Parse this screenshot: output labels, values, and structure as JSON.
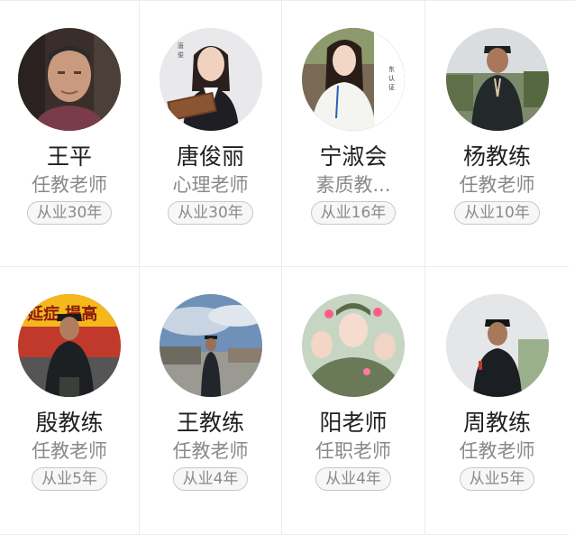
{
  "teachers": [
    {
      "name": "王平",
      "role": "任教老师",
      "years": "从业30年",
      "avatar": "portrait-man-indoor"
    },
    {
      "name": "唐俊丽",
      "role": "心理老师",
      "years": "从业30年",
      "avatar": "portrait-woman-suit-folder"
    },
    {
      "name": "宁淑会",
      "role": "素质教...",
      "years": "从业16年",
      "avatar": "portrait-woman-white-shirt"
    },
    {
      "name": "杨教练",
      "role": "任教老师",
      "years": "从业10年",
      "avatar": "portrait-man-uniform-outdoor"
    },
    {
      "name": "殷教练",
      "role": "任教老师",
      "years": "从业5年",
      "avatar": "portrait-man-uniform-banner"
    },
    {
      "name": "王教练",
      "role": "任教老师",
      "years": "从业4年",
      "avatar": "portrait-man-uniform-sky"
    },
    {
      "name": "阳老师",
      "role": "任职老师",
      "years": "从业4年",
      "avatar": "portrait-women-group-selfie"
    },
    {
      "name": "周教练",
      "role": "任教老师",
      "years": "从业5年",
      "avatar": "portrait-man-uniform-white-bg"
    }
  ]
}
